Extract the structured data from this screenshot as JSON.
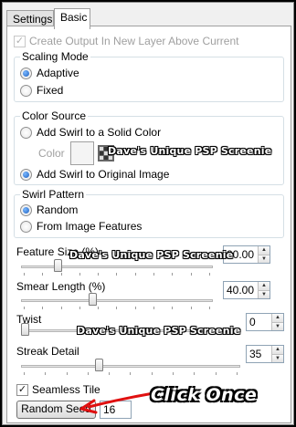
{
  "tabs": [
    {
      "label": "Settings",
      "active": false
    },
    {
      "label": "Basic",
      "active": true
    }
  ],
  "create_output": {
    "label": "Create Output In New Layer Above Current",
    "checked": true,
    "enabled": false
  },
  "scaling_mode": {
    "title": "Scaling Mode",
    "options": [
      {
        "label": "Adaptive",
        "selected": true
      },
      {
        "label": "Fixed",
        "selected": false
      }
    ]
  },
  "color_source": {
    "title": "Color Source",
    "options": [
      {
        "label": "Add Swirl to a Solid Color",
        "selected": false
      },
      {
        "label": "Add Swirl to Original Image",
        "selected": true
      }
    ],
    "color_label": "Color"
  },
  "swirl_pattern": {
    "title": "Swirl Pattern",
    "options": [
      {
        "label": "Random",
        "selected": true
      },
      {
        "label": "From Image Features",
        "selected": false
      }
    ]
  },
  "sliders": [
    {
      "label": "Feature Size (%)",
      "value": "20.00",
      "fraction": 0.18
    },
    {
      "label": "Smear Length (%)",
      "value": "40.00",
      "fraction": 0.37
    },
    {
      "label": "Twist",
      "value": "0",
      "fraction": 0.0
    },
    {
      "label": "Streak Detail",
      "value": "35",
      "fraction": 0.35
    }
  ],
  "seamless_tile": {
    "label": "Seamless Tile",
    "checked": true
  },
  "random_seed": {
    "button_label": "Random Seed",
    "value": "16"
  },
  "watermark": "Dave's Unique PSP Screenie",
  "callout": "Click Once",
  "colors": {
    "accent_arrow": "#e01010",
    "radio_dot": "#1d5fbf",
    "group_border": "#d5dfe5"
  }
}
